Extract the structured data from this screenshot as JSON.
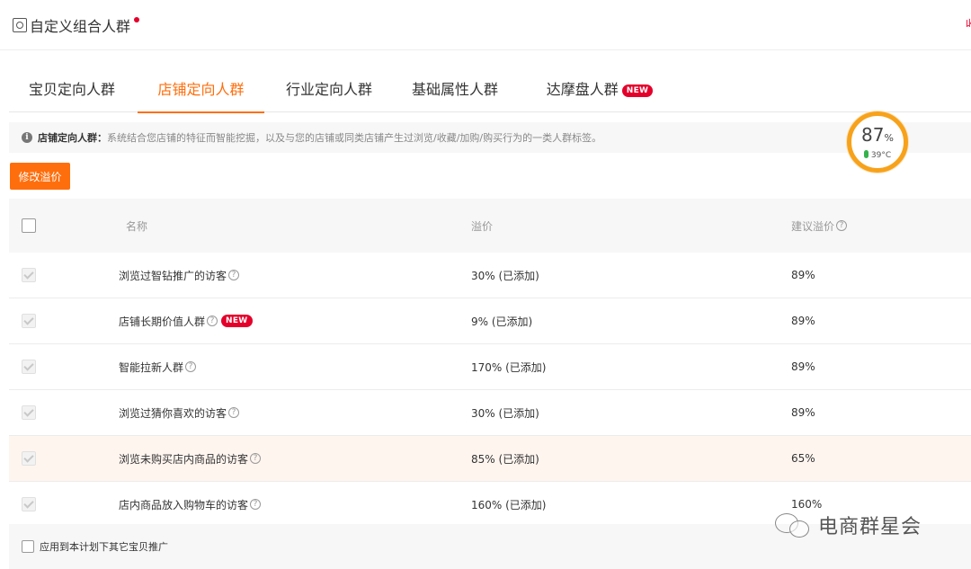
{
  "header": {
    "title": "自定义组合人群",
    "corner_text": "收"
  },
  "tabs": [
    {
      "label": "宝贝定向人群",
      "active": false
    },
    {
      "label": "店铺定向人群",
      "active": true
    },
    {
      "label": "行业定向人群",
      "active": false
    },
    {
      "label": "基础属性人群",
      "active": false
    },
    {
      "label": "达摩盘人群",
      "active": false,
      "badge": "NEW"
    }
  ],
  "info": {
    "label": "店铺定向人群：",
    "text": "系统结合您店铺的特征而智能挖掘，以及与您的店铺或同类店铺产生过浏览/收藏/加购/购买行为的一类人群标签。"
  },
  "gauge": {
    "percent": "87",
    "percent_unit": "%",
    "temperature": "39°C"
  },
  "toolbar": {
    "modify_label": "修改溢价"
  },
  "table": {
    "headers": {
      "name": "名称",
      "premium": "溢价",
      "suggested": "建议溢价"
    },
    "rows": [
      {
        "name": "浏览过智钻推广的访客",
        "premium": "30% (已添加)",
        "suggested": "89%"
      },
      {
        "name": "店铺长期价值人群",
        "premium": "9% (已添加)",
        "suggested": "89%",
        "badge": "NEW"
      },
      {
        "name": "智能拉新人群",
        "premium": "170% (已添加)",
        "suggested": "89%"
      },
      {
        "name": "浏览过猜你喜欢的访客",
        "premium": "30% (已添加)",
        "suggested": "89%"
      },
      {
        "name": "浏览未购买店内商品的访客",
        "premium": "85% (已添加)",
        "suggested": "65%"
      },
      {
        "name": "店内商品放入购物车的访客",
        "premium": "160% (已添加)",
        "suggested": "160%"
      }
    ]
  },
  "footer": {
    "apply_label": "应用到本计划下其它宝贝推广"
  },
  "watermark": {
    "text": "电商群星会"
  },
  "colors": {
    "accent": "#ff6e0c",
    "badge": "#e4002b",
    "gauge": "#f7a21b",
    "row_highlight": "#fff5ef"
  },
  "icons": {
    "help": "?",
    "info": "i"
  }
}
